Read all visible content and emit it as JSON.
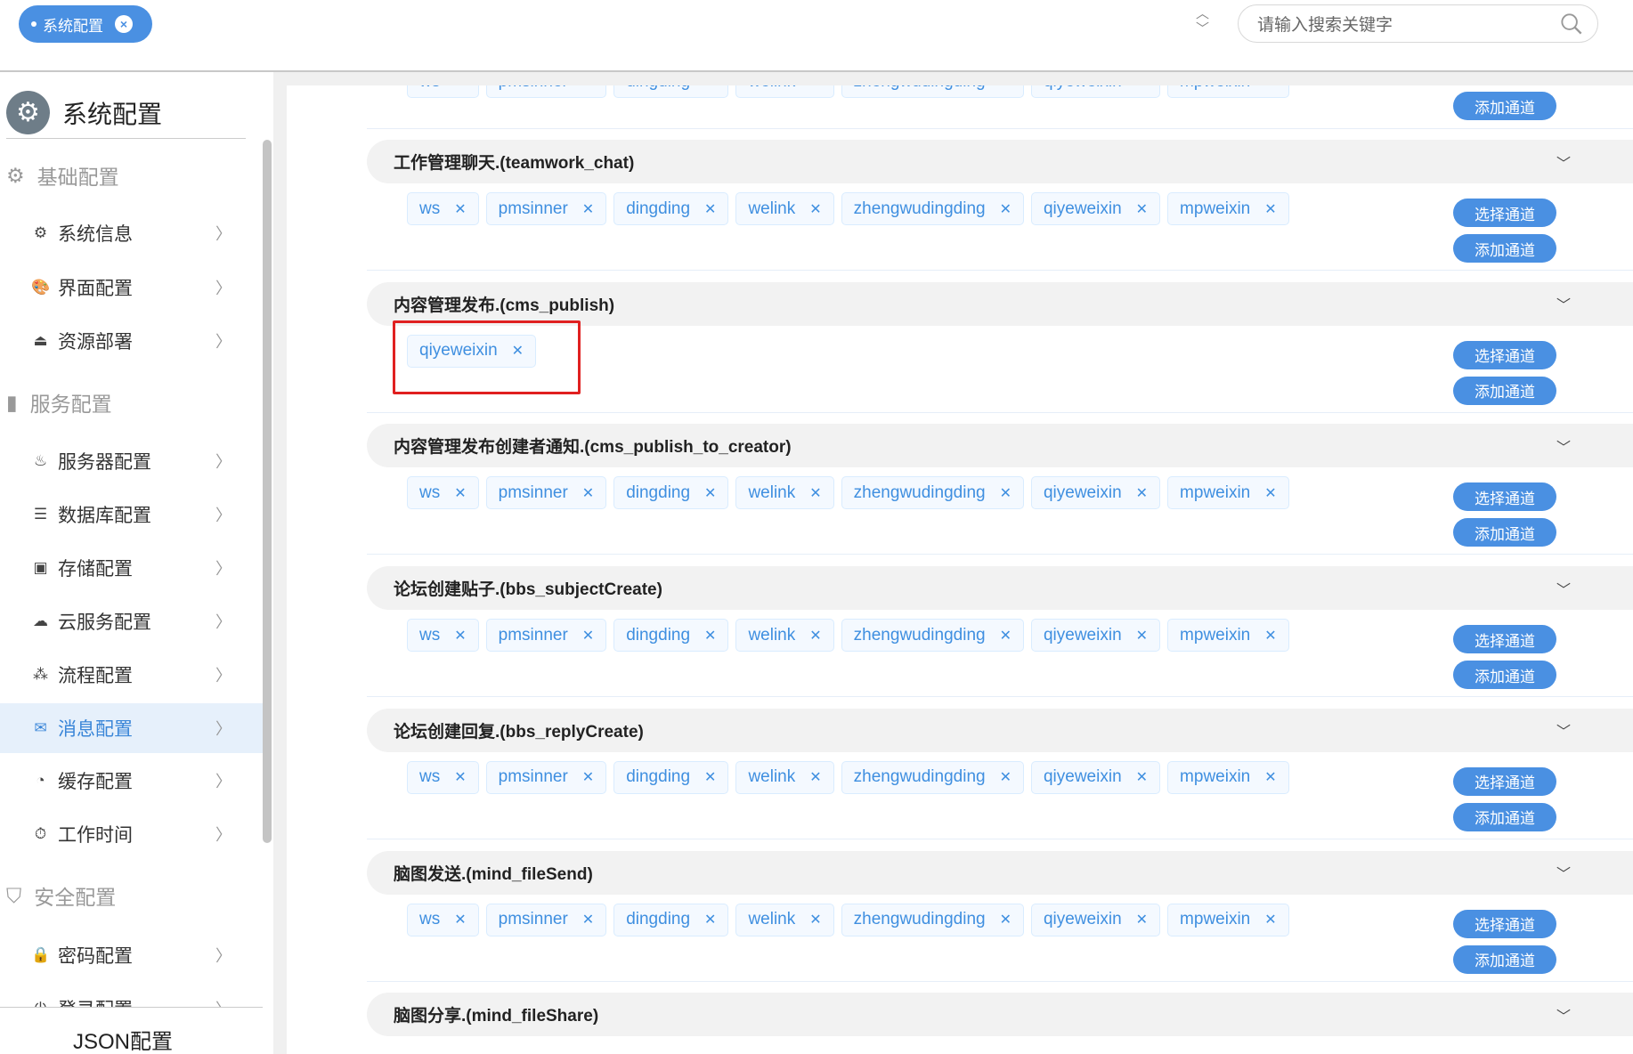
{
  "header": {
    "tab_label": "系统配置",
    "search_placeholder": "请输入搜索关键字"
  },
  "sidebar": {
    "title": "系统配置",
    "groups": [
      {
        "label": "基础配置",
        "icon": "gear-icon"
      },
      {
        "label": "服务配置",
        "icon": "server-icon"
      },
      {
        "label": "安全配置",
        "icon": "shield-icon"
      }
    ],
    "items": [
      {
        "label": "系统信息",
        "icon": "gear-icon",
        "glyph": "⚙"
      },
      {
        "label": "界面配置",
        "icon": "palette-icon",
        "glyph": "🎨"
      },
      {
        "label": "资源部署",
        "icon": "upload-icon",
        "glyph": "⏏"
      },
      {
        "label": "服务器配置",
        "icon": "server-user-icon",
        "glyph": "♨"
      },
      {
        "label": "数据库配置",
        "icon": "database-icon",
        "glyph": "☰"
      },
      {
        "label": "存储配置",
        "icon": "storage-icon",
        "glyph": "▣"
      },
      {
        "label": "云服务配置",
        "icon": "cloud-icon",
        "glyph": "☁"
      },
      {
        "label": "流程配置",
        "icon": "flow-icon",
        "glyph": "⁂"
      },
      {
        "label": "消息配置",
        "icon": "message-icon",
        "glyph": "✉",
        "active": true
      },
      {
        "label": "缓存配置",
        "icon": "pie-icon",
        "glyph": "◔"
      },
      {
        "label": "工作时间",
        "icon": "stopwatch-icon",
        "glyph": "⏱"
      },
      {
        "label": "密码配置",
        "icon": "lock-icon",
        "glyph": "🔒"
      },
      {
        "label": "登录配置",
        "icon": "power-icon",
        "glyph": "⏻"
      }
    ],
    "json_label": "JSON配置"
  },
  "buttons": {
    "select": "选择通道",
    "add": "添加通道"
  },
  "sections": [
    {
      "title": "",
      "tags": [
        "ws",
        "pmsinner",
        "dingding",
        "welink",
        "zhengwudingding",
        "qiyeweixin",
        "mpweixin"
      ],
      "partial": true
    },
    {
      "title": "工作管理聊天.(teamwork_chat)",
      "tags": [
        "ws",
        "pmsinner",
        "dingding",
        "welink",
        "zhengwudingding",
        "qiyeweixin",
        "mpweixin"
      ]
    },
    {
      "title": "内容管理发布.(cms_publish)",
      "tags": [
        "qiyeweixin"
      ],
      "highlight": true
    },
    {
      "title": "内容管理发布创建者通知.(cms_publish_to_creator)",
      "tags": [
        "ws",
        "pmsinner",
        "dingding",
        "welink",
        "zhengwudingding",
        "qiyeweixin",
        "mpweixin"
      ]
    },
    {
      "title": "论坛创建贴子.(bbs_subjectCreate)",
      "tags": [
        "ws",
        "pmsinner",
        "dingding",
        "welink",
        "zhengwudingding",
        "qiyeweixin",
        "mpweixin"
      ]
    },
    {
      "title": "论坛创建回复.(bbs_replyCreate)",
      "tags": [
        "ws",
        "pmsinner",
        "dingding",
        "welink",
        "zhengwudingding",
        "qiyeweixin",
        "mpweixin"
      ]
    },
    {
      "title": "脑图发送.(mind_fileSend)",
      "tags": [
        "ws",
        "pmsinner",
        "dingding",
        "welink",
        "zhengwudingding",
        "qiyeweixin",
        "mpweixin"
      ]
    },
    {
      "title": "脑图分享.(mind_fileShare)",
      "tags": []
    }
  ],
  "colors": {
    "accent": "#4a90e2",
    "highlight": "#e02020",
    "tag_text": "#3f8fe0"
  }
}
